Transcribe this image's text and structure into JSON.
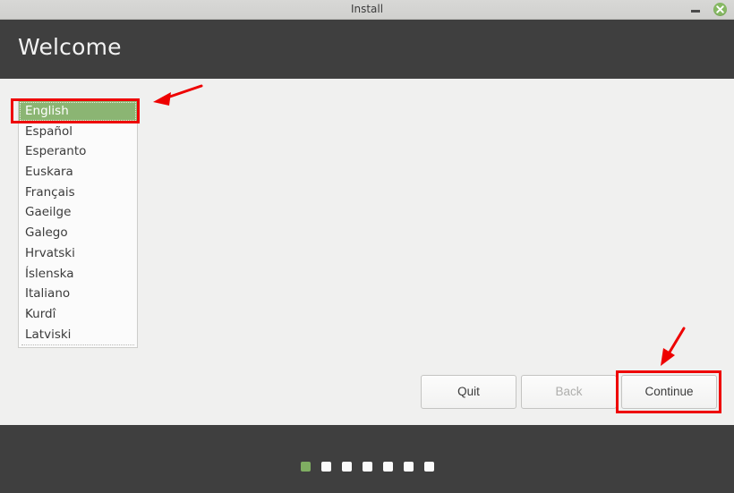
{
  "window": {
    "title": "Install",
    "minimize_icon": "minimize-icon",
    "close_icon": "close-icon",
    "close_button_color": "#86b863"
  },
  "header": {
    "title": "Welcome",
    "background_color": "#3f3f3f"
  },
  "language_list": {
    "selected": "English",
    "selection_color": "#8bb573",
    "items": [
      {
        "label": "English",
        "selected": true
      },
      {
        "label": "Español",
        "selected": false
      },
      {
        "label": "Esperanto",
        "selected": false
      },
      {
        "label": "Euskara",
        "selected": false
      },
      {
        "label": "Français",
        "selected": false
      },
      {
        "label": "Gaeilge",
        "selected": false
      },
      {
        "label": "Galego",
        "selected": false
      },
      {
        "label": "Hrvatski",
        "selected": false
      },
      {
        "label": "Íslenska",
        "selected": false
      },
      {
        "label": "Italiano",
        "selected": false
      },
      {
        "label": "Kurdî",
        "selected": false
      },
      {
        "label": "Latviski",
        "selected": false
      }
    ]
  },
  "footer": {
    "quit_label": "Quit",
    "back_label": "Back",
    "back_disabled": true,
    "continue_label": "Continue"
  },
  "progress_dots": {
    "total": 7,
    "active_index": 0,
    "active_color": "#7fae62",
    "inactive_color": "#fbfbfb"
  },
  "annotations": {
    "color": "#ee0000",
    "highlight_language": "English",
    "highlight_button": "Continue",
    "arrow_to_language": "arrow-pointing-to-english",
    "arrow_to_continue": "arrow-pointing-to-continue"
  }
}
